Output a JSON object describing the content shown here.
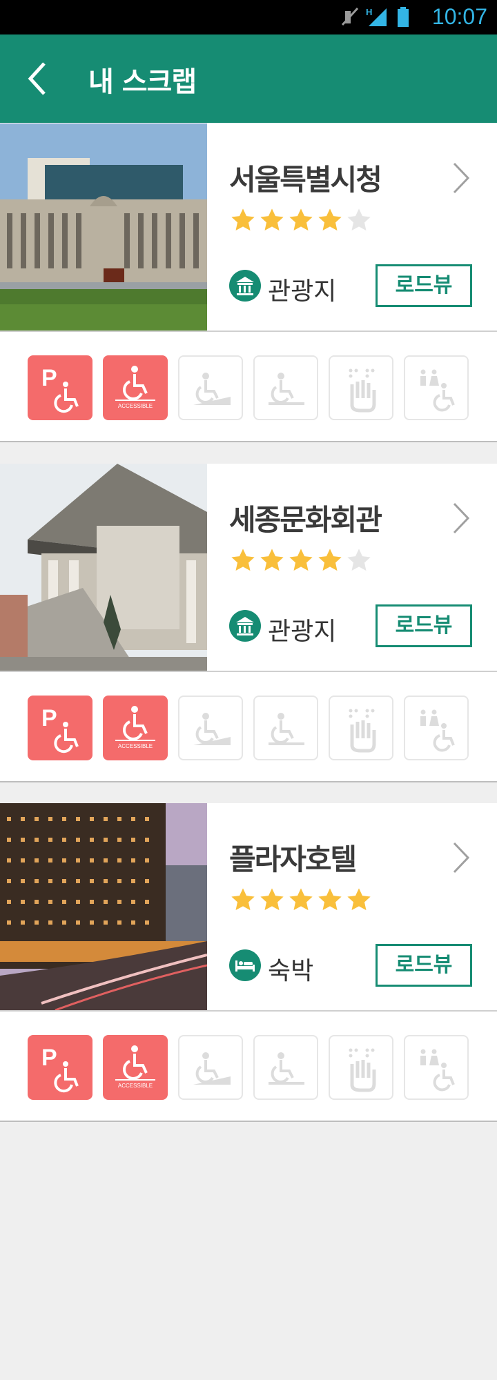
{
  "status_bar": {
    "time": "10:07",
    "network": "H"
  },
  "header": {
    "title": "내 스크랩"
  },
  "places": [
    {
      "name": "서울특별시청",
      "rating": 4,
      "max_rating": 5,
      "category": "관광지",
      "category_icon": "landmark-icon",
      "roadview_label": "로드뷰",
      "photo": "city-hall-photo",
      "features": [
        {
          "icon": "parking-accessible-icon",
          "active": true,
          "caption": ""
        },
        {
          "icon": "wheelchair-accessible-icon",
          "active": true,
          "caption": "ACCESSIBLE"
        },
        {
          "icon": "ramp-icon",
          "active": false,
          "caption": ""
        },
        {
          "icon": "elevator-icon",
          "active": false,
          "caption": ""
        },
        {
          "icon": "braille-icon",
          "active": false,
          "caption": ""
        },
        {
          "icon": "accessible-restroom-icon",
          "active": false,
          "caption": ""
        }
      ]
    },
    {
      "name": "세종문화회관",
      "rating": 4,
      "max_rating": 5,
      "category": "관광지",
      "category_icon": "landmark-icon",
      "roadview_label": "로드뷰",
      "photo": "sejong-center-photo",
      "features": [
        {
          "icon": "parking-accessible-icon",
          "active": true,
          "caption": ""
        },
        {
          "icon": "wheelchair-accessible-icon",
          "active": true,
          "caption": "ACCESSIBLE"
        },
        {
          "icon": "ramp-icon",
          "active": false,
          "caption": ""
        },
        {
          "icon": "elevator-icon",
          "active": false,
          "caption": ""
        },
        {
          "icon": "braille-icon",
          "active": false,
          "caption": ""
        },
        {
          "icon": "accessible-restroom-icon",
          "active": false,
          "caption": ""
        }
      ]
    },
    {
      "name": "플라자호텔",
      "rating": 5,
      "max_rating": 5,
      "category": "숙박",
      "category_icon": "bed-icon",
      "roadview_label": "로드뷰",
      "photo": "plaza-hotel-photo",
      "features": [
        {
          "icon": "parking-accessible-icon",
          "active": true,
          "caption": ""
        },
        {
          "icon": "wheelchair-accessible-icon",
          "active": true,
          "caption": "ACCESSIBLE"
        },
        {
          "icon": "ramp-icon",
          "active": false,
          "caption": ""
        },
        {
          "icon": "elevator-icon",
          "active": false,
          "caption": ""
        },
        {
          "icon": "braille-icon",
          "active": false,
          "caption": ""
        },
        {
          "icon": "accessible-restroom-icon",
          "active": false,
          "caption": ""
        }
      ]
    }
  ],
  "colors": {
    "primary": "#168c73",
    "feature_active": "#f46b6b",
    "star_on": "#f9bf3b",
    "star_off": "#e5e5e5",
    "background": "#efefef"
  }
}
